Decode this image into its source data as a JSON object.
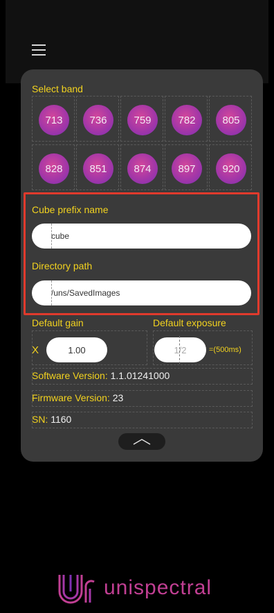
{
  "select_band": {
    "label": "Select band",
    "bands": [
      "713",
      "736",
      "759",
      "782",
      "805",
      "828",
      "851",
      "874",
      "897",
      "920"
    ]
  },
  "cube_prefix": {
    "label": "Cube prefix name",
    "value": "cube"
  },
  "directory": {
    "label": "Directory path",
    "value": "/uns/SavedImages"
  },
  "gain": {
    "label": "Default gain",
    "prefix": "X",
    "value": "1.00"
  },
  "exposure": {
    "label": "Default exposure",
    "value": "1/2",
    "suffix": "=(500ms)"
  },
  "software": {
    "label": "Software Version:",
    "value": "1.1.01241000"
  },
  "firmware": {
    "label": "Firmware Version:",
    "value": "23"
  },
  "sn": {
    "label": "SN:",
    "value": "1160"
  },
  "brand": {
    "name": "unispectral"
  },
  "colors": {
    "accent": "#f2d21f",
    "band": "#a437a7",
    "highlight": "#e03a2c",
    "brand": "#c13f93"
  }
}
